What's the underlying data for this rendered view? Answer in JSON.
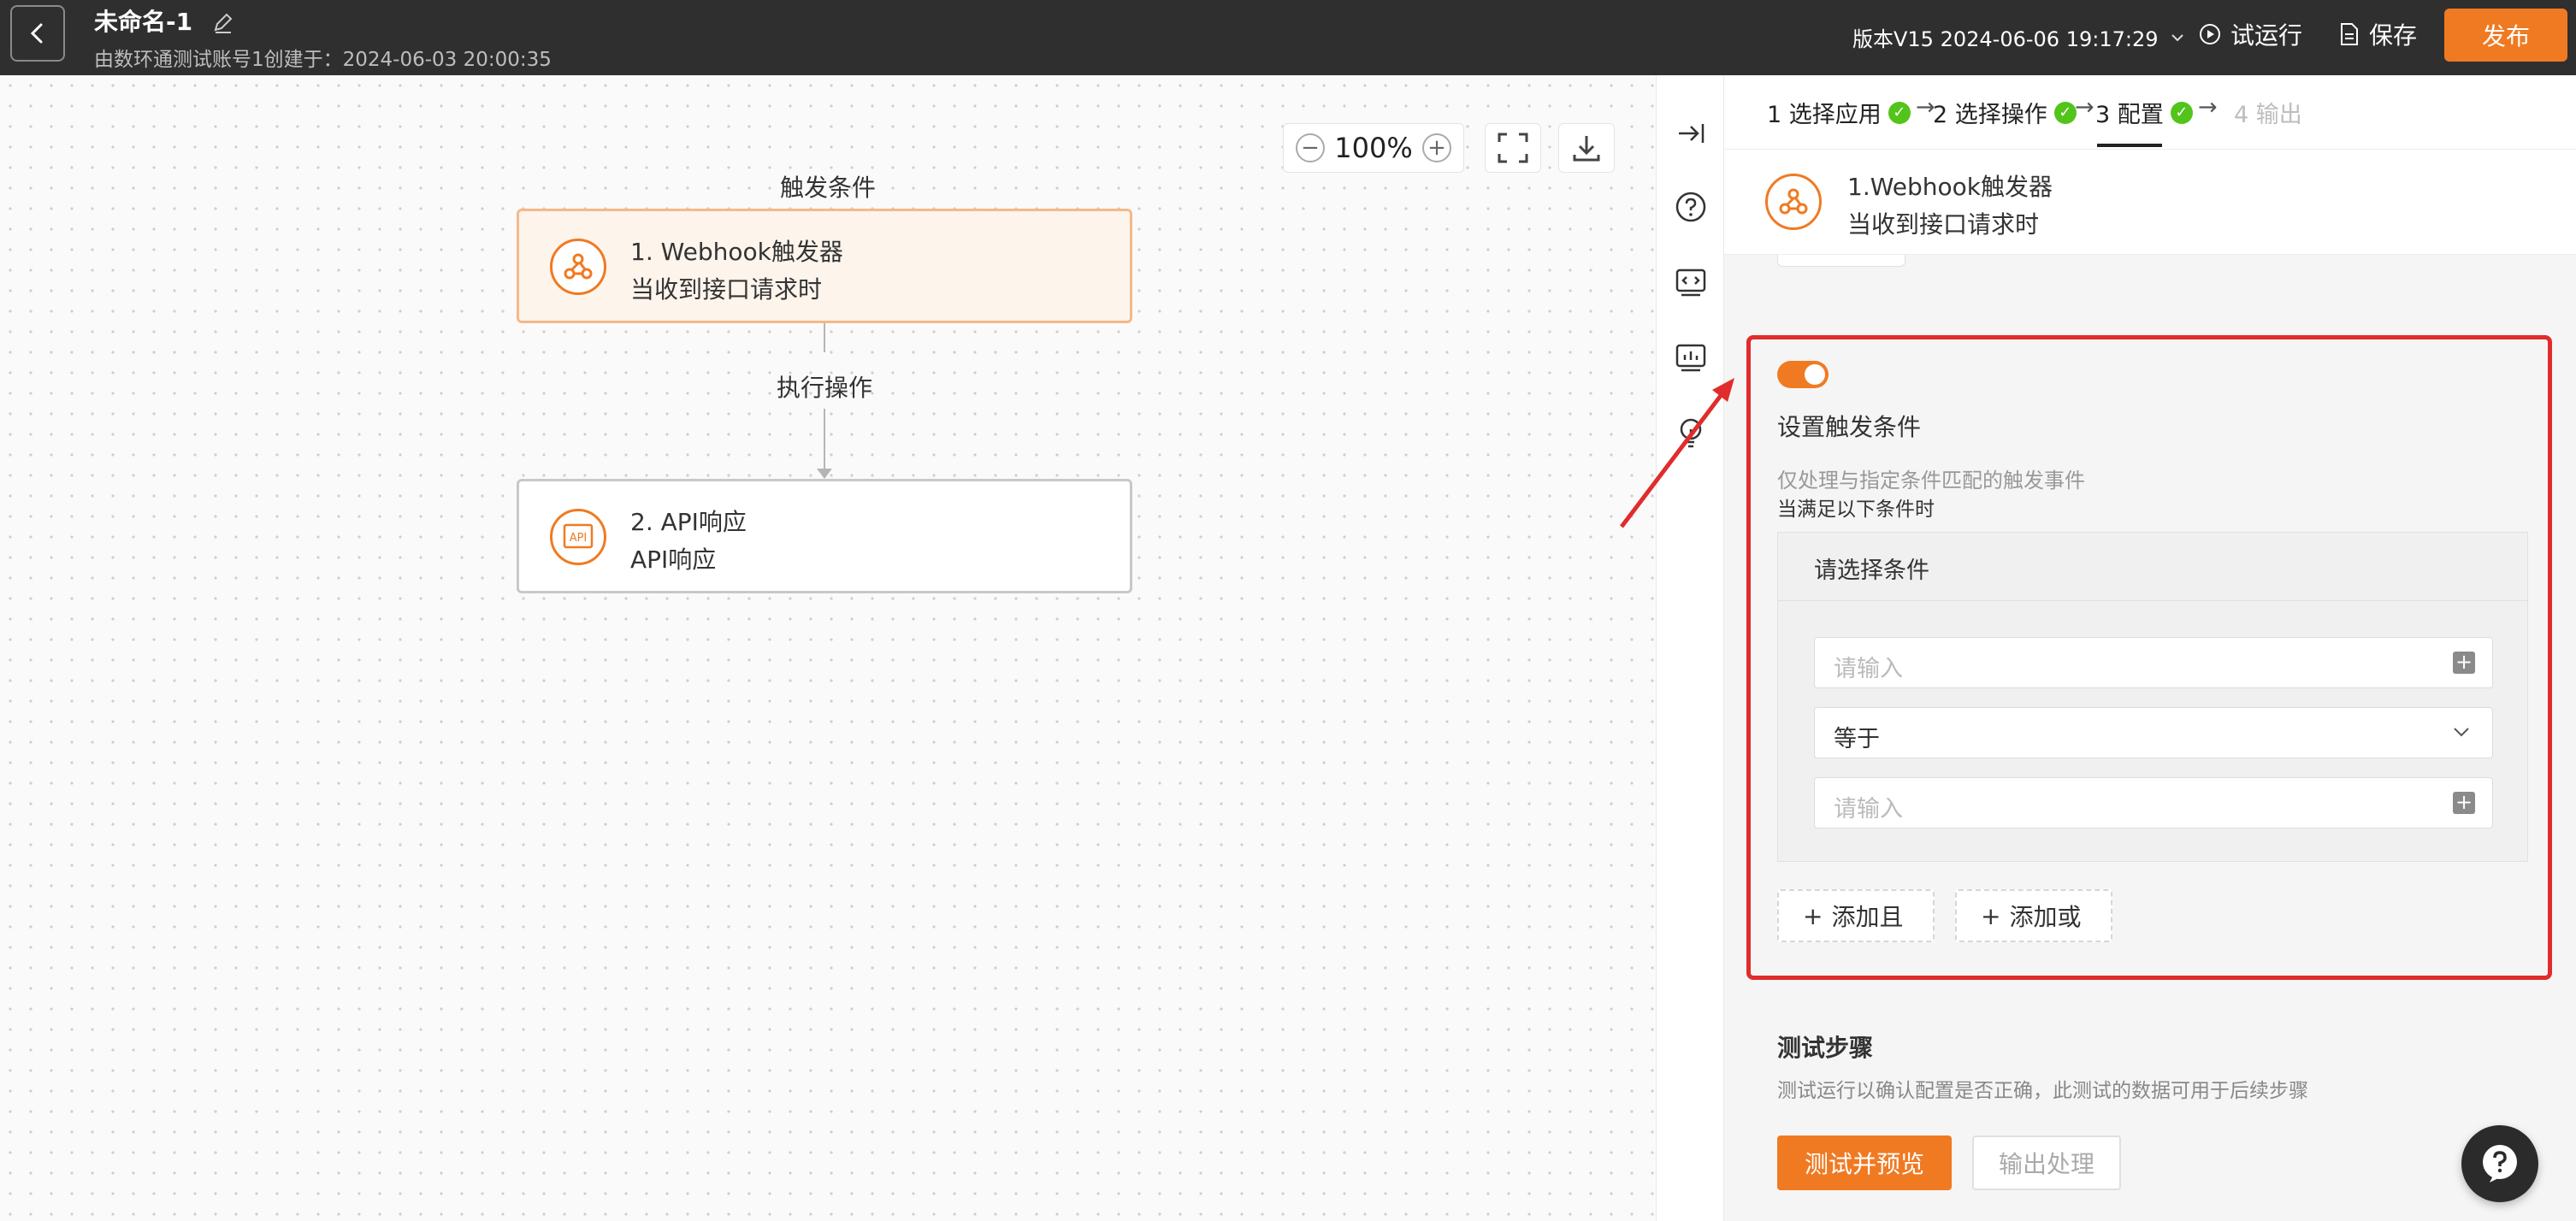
{
  "header": {
    "back_icon": "chevron-left-icon",
    "title": "未命名-1",
    "subtitle": "由数环通测试账号1创建于：2024-06-03 20:00:35",
    "version": "版本V15 2024-06-06 19:17:29",
    "trial_run": "试运行",
    "save": "保存",
    "publish": "发布",
    "accent_color": "#f07a22"
  },
  "canvas": {
    "zoom": "100%",
    "trigger_label": "触发条件",
    "exec_label": "执行操作",
    "nodes": [
      {
        "title": "1. Webhook触发器",
        "sub": "当收到接口请求时",
        "icon": "webhook-icon"
      },
      {
        "title": "2. API响应",
        "sub": "API响应",
        "icon": "api-icon",
        "icon_text": "API"
      }
    ]
  },
  "steps": [
    {
      "label": "1 选择应用",
      "done": true
    },
    {
      "label": "2 选择操作",
      "done": true
    },
    {
      "label": "3 配置",
      "done": true,
      "active": true
    },
    {
      "label": "4 输出",
      "done": false
    }
  ],
  "app_card": {
    "title": "1.Webhook触发器",
    "sub": "当收到接口请求时"
  },
  "condition": {
    "enabled": true,
    "title": "设置触发条件",
    "desc": "仅处理与指定条件匹配的触发事件",
    "when": "当满足以下条件时",
    "box_header": "请选择条件",
    "field1_placeholder": "请输入",
    "operator": "等于",
    "field2_placeholder": "请输入",
    "add_and": "添加且",
    "add_or": "添加或"
  },
  "test": {
    "title": "测试步骤",
    "desc": "测试运行以确认配置是否正确，此测试的数据可用于后续步骤",
    "test_button": "测试并预览",
    "output_button": "输出处理"
  }
}
